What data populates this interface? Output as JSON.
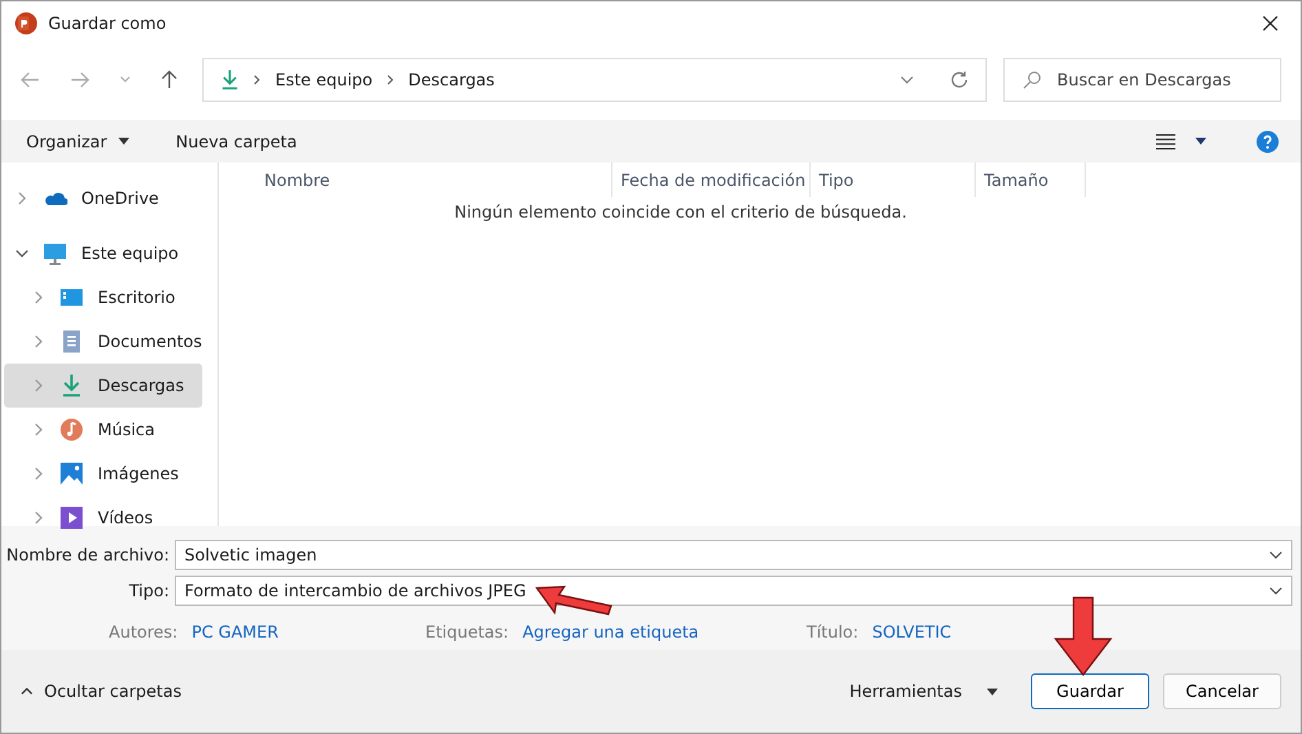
{
  "window": {
    "title": "Guardar como"
  },
  "breadcrumb": [
    "Este equipo",
    "Descargas"
  ],
  "search": {
    "placeholder": "Buscar en Descargas"
  },
  "toolbar": {
    "organize": "Organizar",
    "new_folder": "Nueva carpeta"
  },
  "columns": [
    "Nombre",
    "Fecha de modificación",
    "Tipo",
    "Tamaño"
  ],
  "empty_message": "Ningún elemento coincide con el criterio de búsqueda.",
  "sidebar": {
    "items": [
      {
        "label": "OneDrive",
        "kind": "cloud",
        "expanded": false,
        "selected": false
      },
      {
        "label": "Este equipo",
        "kind": "computer",
        "expanded": true,
        "selected": false,
        "children": [
          {
            "label": "Escritorio",
            "kind": "desktop",
            "expanded": false,
            "selected": false
          },
          {
            "label": "Documentos",
            "kind": "document",
            "expanded": false,
            "selected": false
          },
          {
            "label": "Descargas",
            "kind": "download",
            "expanded": false,
            "selected": true
          },
          {
            "label": "Música",
            "kind": "music",
            "expanded": false,
            "selected": false
          },
          {
            "label": "Imágenes",
            "kind": "pictures",
            "expanded": false,
            "selected": false
          },
          {
            "label": "Vídeos",
            "kind": "video",
            "expanded": false,
            "selected": false
          }
        ]
      }
    ]
  },
  "fields": [
    {
      "label": "Nombre de archivo:",
      "value": "Solvetic imagen"
    },
    {
      "label": "Tipo:",
      "value": "Formato de intercambio de archivos JPEG"
    }
  ],
  "metadata": [
    {
      "label": "Autores:",
      "value": "PC GAMER"
    },
    {
      "label": "Etiquetas:",
      "value": "Agregar una etiqueta"
    },
    {
      "label": "Título:",
      "value": "SOLVETIC"
    }
  ],
  "footer": {
    "hide_folders": "Ocultar carpetas",
    "tools": "Herramientas",
    "save": "Guardar",
    "cancel": "Cancelar"
  }
}
